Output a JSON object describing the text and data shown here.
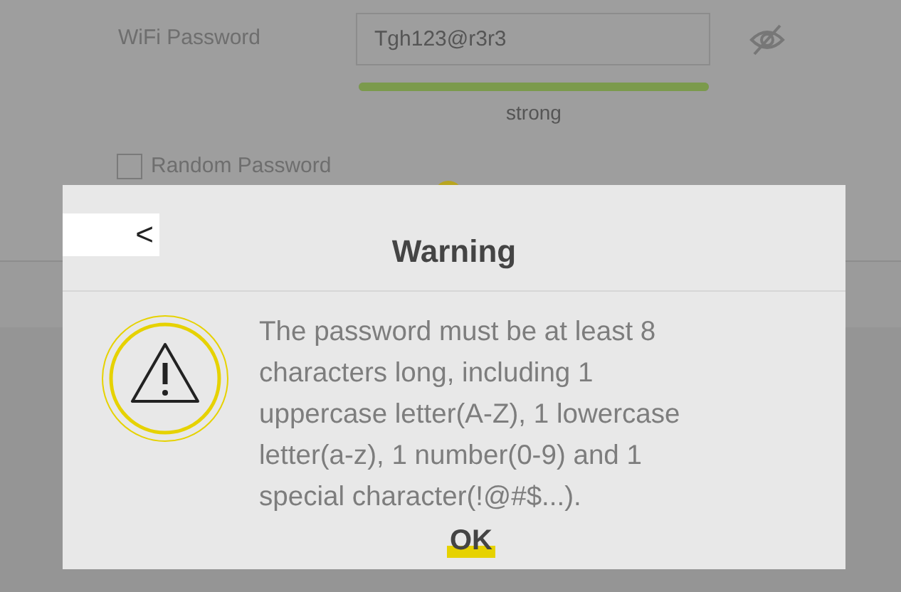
{
  "form": {
    "password_label": "WiFi Password",
    "password_value": "Tgh123@r3r3",
    "password_visible": true,
    "strength": {
      "level": 1,
      "label": "strong"
    },
    "random_password": {
      "label": "Random Password",
      "checked": false
    }
  },
  "dialog": {
    "back": "<",
    "title": "Warning",
    "message": "The password must be at least 8 characters long, including 1 uppercase letter(A-Z), 1 lowercase letter(a-z), 1 number(0-9) and 1 special character(!@#$...).",
    "ok": "OK"
  }
}
